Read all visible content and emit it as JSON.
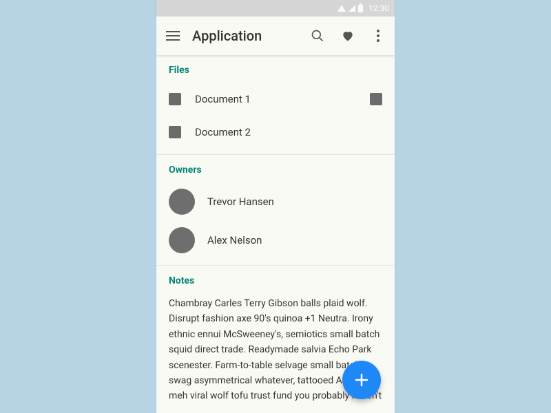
{
  "status": {
    "time": "12:30"
  },
  "appbar": {
    "title": "Application"
  },
  "sections": {
    "files": {
      "title": "Files",
      "items": [
        {
          "label": "Document 1",
          "trailing": true
        },
        {
          "label": "Document 2",
          "trailing": false
        }
      ]
    },
    "owners": {
      "title": "Owners",
      "items": [
        {
          "name": "Trevor Hansen"
        },
        {
          "name": "Alex Nelson"
        }
      ]
    },
    "notes": {
      "title": "Notes",
      "body": "Chambray Carles Terry Gibson balls plaid wolf. Disrupt fashion axe 90's quinoa +1 Neutra. Irony ethnic ennui McSweeney's, semiotics small batch squid direct trade. Readymade salvia Echo Park scenester. Farm-to-table selvage small batch swag asymmetrical whatever, tattooed American meh viral wolf tofu trust fund you probably haven't"
    }
  }
}
